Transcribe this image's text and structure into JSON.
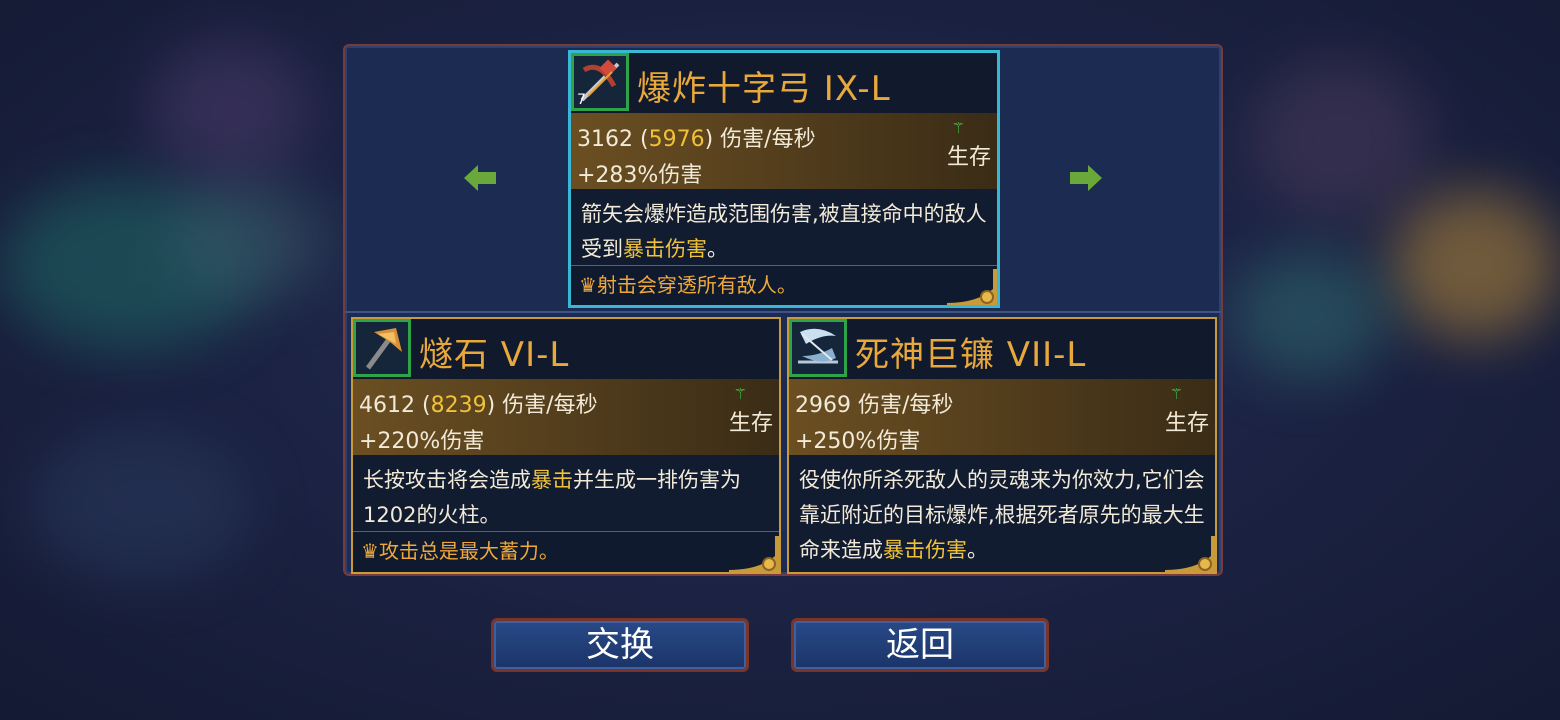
{
  "nav": {
    "prev_label": "",
    "next_label": ""
  },
  "colors": {
    "accent_gold": "#e8a83c",
    "highlight": "#f0c23a",
    "survival_green": "#47d45a",
    "selected_border": "#39b8d6"
  },
  "cards": [
    {
      "name": "爆炸十字弓 IX-L",
      "icon": "crossbow-icon",
      "icon_badge": "7",
      "dps_base": "3162",
      "dps_open": " (",
      "dps_crit": "5976",
      "dps_close": ") 伤害/每秒",
      "bonus": "+283%伤害",
      "stat_type": "生存",
      "desc_part1": "箭矢会爆炸造成范围伤害,被直接命中的敌人受到",
      "desc_hl": "暴击伤害",
      "desc_part2": "。",
      "legendary": "射击会穿透所有敌人。"
    },
    {
      "name": "燧石 VI-L",
      "icon": "hammer-icon",
      "dps_base": "4612",
      "dps_open": " (",
      "dps_crit": "8239",
      "dps_close": ") 伤害/每秒",
      "bonus": "+220%伤害",
      "stat_type": "生存",
      "desc_part1": "长按攻击将会造成",
      "desc_hl": "暴击",
      "desc_part2": "并生成一排伤害为1202的火柱。",
      "legendary": "攻击总是最大蓄力。"
    },
    {
      "name": "死神巨镰 VII-L",
      "icon": "scythe-icon",
      "dps_base": "2969",
      "dps_close": " 伤害/每秒",
      "bonus": "+250%伤害",
      "stat_type": "生存",
      "desc_part1": "役使你所杀死敌人的灵魂来为你效力,它们会靠近附近的目标爆炸,根据死者原先的最大生命来造成",
      "desc_hl": "暴击伤害",
      "desc_part2": "。"
    }
  ],
  "buttons": {
    "swap": "交换",
    "back": "返回"
  }
}
